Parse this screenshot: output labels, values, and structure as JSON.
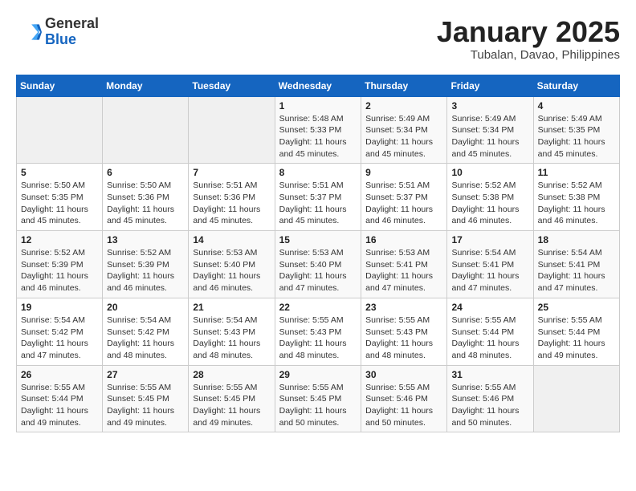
{
  "header": {
    "logo_general": "General",
    "logo_blue": "Blue",
    "month": "January 2025",
    "location": "Tubalan, Davao, Philippines"
  },
  "weekdays": [
    "Sunday",
    "Monday",
    "Tuesday",
    "Wednesday",
    "Thursday",
    "Friday",
    "Saturday"
  ],
  "weeks": [
    [
      {
        "day": "",
        "info": ""
      },
      {
        "day": "",
        "info": ""
      },
      {
        "day": "",
        "info": ""
      },
      {
        "day": "1",
        "info": "Sunrise: 5:48 AM\nSunset: 5:33 PM\nDaylight: 11 hours and 45 minutes."
      },
      {
        "day": "2",
        "info": "Sunrise: 5:49 AM\nSunset: 5:34 PM\nDaylight: 11 hours and 45 minutes."
      },
      {
        "day": "3",
        "info": "Sunrise: 5:49 AM\nSunset: 5:34 PM\nDaylight: 11 hours and 45 minutes."
      },
      {
        "day": "4",
        "info": "Sunrise: 5:49 AM\nSunset: 5:35 PM\nDaylight: 11 hours and 45 minutes."
      }
    ],
    [
      {
        "day": "5",
        "info": "Sunrise: 5:50 AM\nSunset: 5:35 PM\nDaylight: 11 hours and 45 minutes."
      },
      {
        "day": "6",
        "info": "Sunrise: 5:50 AM\nSunset: 5:36 PM\nDaylight: 11 hours and 45 minutes."
      },
      {
        "day": "7",
        "info": "Sunrise: 5:51 AM\nSunset: 5:36 PM\nDaylight: 11 hours and 45 minutes."
      },
      {
        "day": "8",
        "info": "Sunrise: 5:51 AM\nSunset: 5:37 PM\nDaylight: 11 hours and 45 minutes."
      },
      {
        "day": "9",
        "info": "Sunrise: 5:51 AM\nSunset: 5:37 PM\nDaylight: 11 hours and 46 minutes."
      },
      {
        "day": "10",
        "info": "Sunrise: 5:52 AM\nSunset: 5:38 PM\nDaylight: 11 hours and 46 minutes."
      },
      {
        "day": "11",
        "info": "Sunrise: 5:52 AM\nSunset: 5:38 PM\nDaylight: 11 hours and 46 minutes."
      }
    ],
    [
      {
        "day": "12",
        "info": "Sunrise: 5:52 AM\nSunset: 5:39 PM\nDaylight: 11 hours and 46 minutes."
      },
      {
        "day": "13",
        "info": "Sunrise: 5:52 AM\nSunset: 5:39 PM\nDaylight: 11 hours and 46 minutes."
      },
      {
        "day": "14",
        "info": "Sunrise: 5:53 AM\nSunset: 5:40 PM\nDaylight: 11 hours and 46 minutes."
      },
      {
        "day": "15",
        "info": "Sunrise: 5:53 AM\nSunset: 5:40 PM\nDaylight: 11 hours and 47 minutes."
      },
      {
        "day": "16",
        "info": "Sunrise: 5:53 AM\nSunset: 5:41 PM\nDaylight: 11 hours and 47 minutes."
      },
      {
        "day": "17",
        "info": "Sunrise: 5:54 AM\nSunset: 5:41 PM\nDaylight: 11 hours and 47 minutes."
      },
      {
        "day": "18",
        "info": "Sunrise: 5:54 AM\nSunset: 5:41 PM\nDaylight: 11 hours and 47 minutes."
      }
    ],
    [
      {
        "day": "19",
        "info": "Sunrise: 5:54 AM\nSunset: 5:42 PM\nDaylight: 11 hours and 47 minutes."
      },
      {
        "day": "20",
        "info": "Sunrise: 5:54 AM\nSunset: 5:42 PM\nDaylight: 11 hours and 48 minutes."
      },
      {
        "day": "21",
        "info": "Sunrise: 5:54 AM\nSunset: 5:43 PM\nDaylight: 11 hours and 48 minutes."
      },
      {
        "day": "22",
        "info": "Sunrise: 5:55 AM\nSunset: 5:43 PM\nDaylight: 11 hours and 48 minutes."
      },
      {
        "day": "23",
        "info": "Sunrise: 5:55 AM\nSunset: 5:43 PM\nDaylight: 11 hours and 48 minutes."
      },
      {
        "day": "24",
        "info": "Sunrise: 5:55 AM\nSunset: 5:44 PM\nDaylight: 11 hours and 48 minutes."
      },
      {
        "day": "25",
        "info": "Sunrise: 5:55 AM\nSunset: 5:44 PM\nDaylight: 11 hours and 49 minutes."
      }
    ],
    [
      {
        "day": "26",
        "info": "Sunrise: 5:55 AM\nSunset: 5:44 PM\nDaylight: 11 hours and 49 minutes."
      },
      {
        "day": "27",
        "info": "Sunrise: 5:55 AM\nSunset: 5:45 PM\nDaylight: 11 hours and 49 minutes."
      },
      {
        "day": "28",
        "info": "Sunrise: 5:55 AM\nSunset: 5:45 PM\nDaylight: 11 hours and 49 minutes."
      },
      {
        "day": "29",
        "info": "Sunrise: 5:55 AM\nSunset: 5:45 PM\nDaylight: 11 hours and 50 minutes."
      },
      {
        "day": "30",
        "info": "Sunrise: 5:55 AM\nSunset: 5:46 PM\nDaylight: 11 hours and 50 minutes."
      },
      {
        "day": "31",
        "info": "Sunrise: 5:55 AM\nSunset: 5:46 PM\nDaylight: 11 hours and 50 minutes."
      },
      {
        "day": "",
        "info": ""
      }
    ]
  ]
}
